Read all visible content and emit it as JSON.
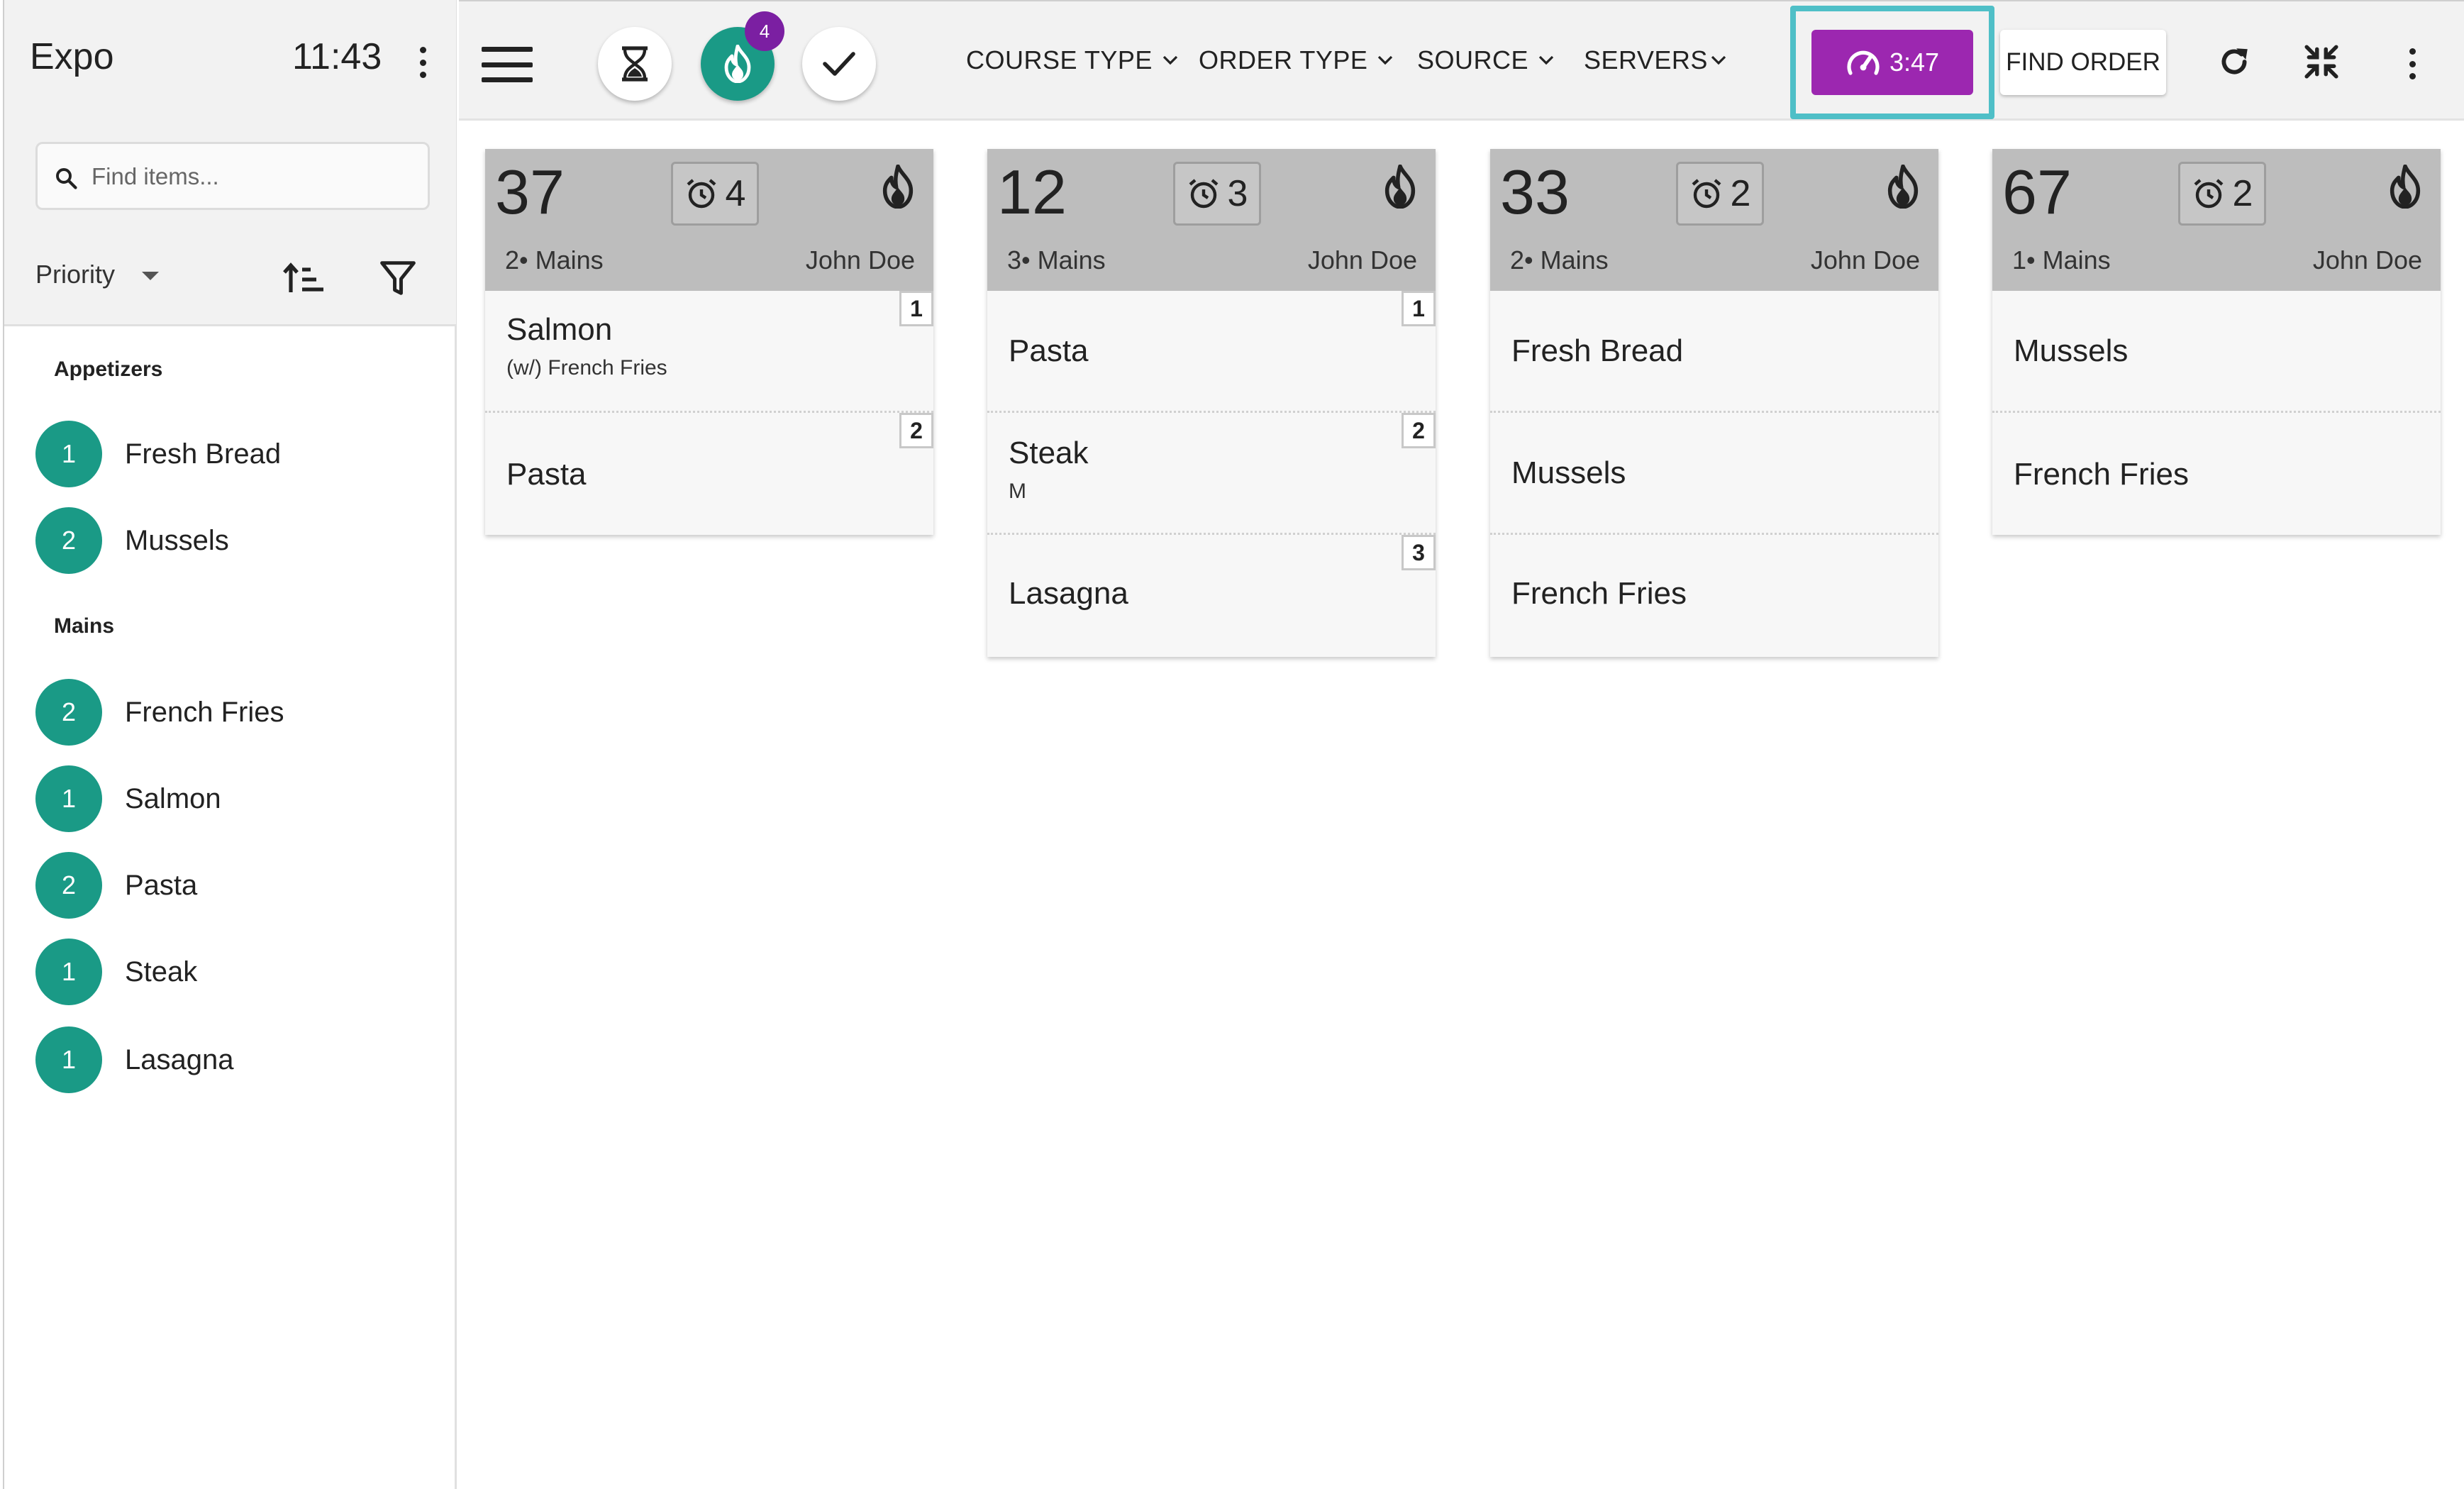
{
  "sidebar": {
    "title": "Expo",
    "time": "11:43",
    "search_placeholder": "Find items...",
    "sort_label": "Priority",
    "sections": [
      {
        "label": "Appetizers",
        "items": [
          {
            "count": "1",
            "name": "Fresh Bread"
          },
          {
            "count": "2",
            "name": "Mussels"
          }
        ]
      },
      {
        "label": "Mains",
        "items": [
          {
            "count": "2",
            "name": "French Fries"
          },
          {
            "count": "1",
            "name": "Salmon"
          },
          {
            "count": "2",
            "name": "Pasta"
          },
          {
            "count": "1",
            "name": "Steak"
          },
          {
            "count": "1",
            "name": "Lasagna"
          }
        ]
      }
    ]
  },
  "toolbar": {
    "fire_badge_count": "4",
    "filters": [
      "COURSE TYPE",
      "ORDER TYPE",
      "SOURCE",
      "SERVERS"
    ],
    "timer_label": "3:47",
    "find_order_label": "FIND ORDER"
  },
  "orders": [
    {
      "number": "37",
      "alarm": "4",
      "course": "2• Mains",
      "server": "John Doe",
      "items": [
        {
          "name": "Salmon",
          "modifier": "(w/) French Fries",
          "seat": "1"
        },
        {
          "name": "Pasta",
          "modifier": "",
          "seat": "2"
        }
      ]
    },
    {
      "number": "12",
      "alarm": "3",
      "course": "3• Mains",
      "server": "John Doe",
      "items": [
        {
          "name": "Pasta",
          "modifier": "",
          "seat": "1"
        },
        {
          "name": "Steak",
          "modifier": "M",
          "seat": "2"
        },
        {
          "name": "Lasagna",
          "modifier": "",
          "seat": "3"
        }
      ]
    },
    {
      "number": "33",
      "alarm": "2",
      "course": "2• Mains",
      "server": "John Doe",
      "items": [
        {
          "name": "Fresh Bread",
          "modifier": "",
          "seat": ""
        },
        {
          "name": "Mussels",
          "modifier": "",
          "seat": ""
        },
        {
          "name": "French Fries",
          "modifier": "",
          "seat": ""
        }
      ]
    },
    {
      "number": "67",
      "alarm": "2",
      "course": "1• Mains",
      "server": "John Doe",
      "items": [
        {
          "name": "Mussels",
          "modifier": "",
          "seat": ""
        },
        {
          "name": "French Fries",
          "modifier": "",
          "seat": ""
        }
      ]
    }
  ],
  "colors": {
    "teal": "#1a9a86",
    "purple": "#9c27b0",
    "badge_purple": "#7b1fa2",
    "highlight": "#4fbfc7"
  }
}
